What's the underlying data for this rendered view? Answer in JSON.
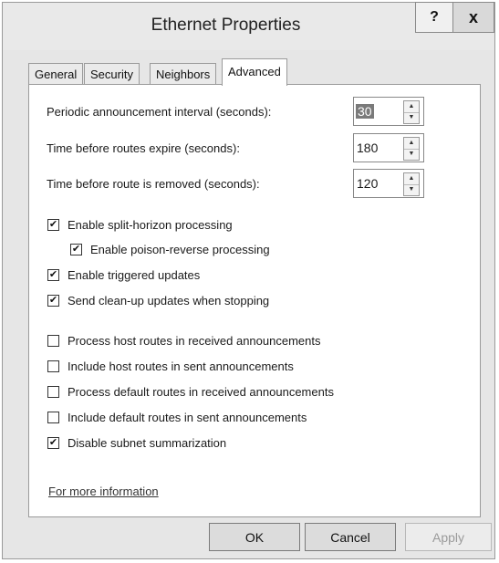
{
  "window": {
    "title": "Ethernet Properties",
    "help_label": "?",
    "close_label": "x"
  },
  "tabs": [
    {
      "label": "General"
    },
    {
      "label": "Security"
    },
    {
      "label": "Neighbors"
    },
    {
      "label": "Advanced",
      "active": true
    }
  ],
  "fields": [
    {
      "label": "Periodic announcement interval (seconds):",
      "value": "30"
    },
    {
      "label": "Time before routes expire (seconds):",
      "value": "180"
    },
    {
      "label": "Time before route is removed (seconds):",
      "value": "120"
    }
  ],
  "checkboxes": [
    {
      "label": "Enable split-horizon processing",
      "checked": true
    },
    {
      "label": "Enable poison-reverse processing",
      "checked": true
    },
    {
      "label": "Enable triggered updates",
      "checked": true
    },
    {
      "label": "Send clean-up updates when stopping",
      "checked": true
    },
    {
      "label": "Process host routes in received announcements",
      "checked": false
    },
    {
      "label": "Include host routes in sent announcements",
      "checked": false
    },
    {
      "label": "Process default routes in received announcements",
      "checked": false
    },
    {
      "label": "Include default routes in sent announcements",
      "checked": false
    },
    {
      "label": "Disable subnet summarization",
      "checked": true
    }
  ],
  "check_mark": "✔",
  "link_text": "For more information",
  "buttons": {
    "ok": "OK",
    "cancel": "Cancel",
    "apply": "Apply"
  },
  "spin_icons": {
    "up": "▲",
    "down": "▼"
  }
}
